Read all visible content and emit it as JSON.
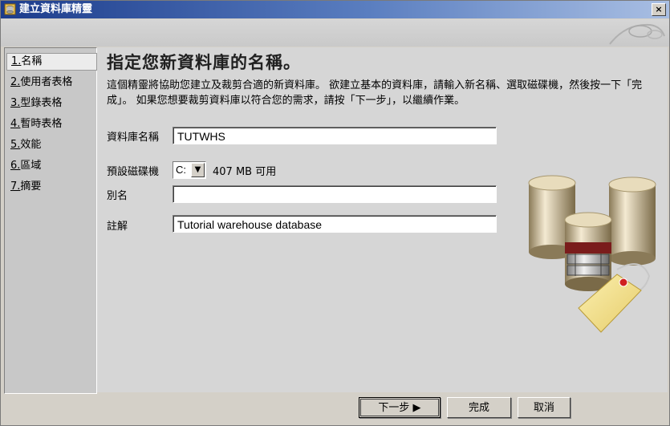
{
  "window": {
    "title": "建立資料庫精靈",
    "close_glyph": "×"
  },
  "steps": [
    {
      "num": "1.",
      "label": "名稱",
      "active": true
    },
    {
      "num": "2.",
      "label": "使用者表格"
    },
    {
      "num": "3.",
      "label": "型錄表格"
    },
    {
      "num": "4.",
      "label": "暫時表格"
    },
    {
      "num": "5.",
      "label": "效能"
    },
    {
      "num": "6.",
      "label": "區域"
    },
    {
      "num": "7.",
      "label": "摘要"
    }
  ],
  "main": {
    "heading": "指定您新資料庫的名稱。",
    "description": "這個精靈將協助您建立及裁剪合適的新資料庫。 欲建立基本的資料庫，請輸入新名稱、選取磁碟機，然後按一下「完成」。 如果您想要裁剪資料庫以符合您的需求，請按「下一步」，以繼續作業。",
    "db_name_label": "資料庫名稱",
    "db_name_value": "TUTWHS",
    "drive_label": "預設磁碟機",
    "drive_value": "C:",
    "drive_space": "407 MB 可用",
    "alias_label": "別名",
    "alias_value": "",
    "comment_label": "註解",
    "comment_value": "Tutorial warehouse database"
  },
  "buttons": {
    "next": "下一步 ▶",
    "finish": "完成",
    "cancel": "取消"
  },
  "icons": {
    "drive_dropdown": "chevron-down-icon",
    "title_icon": "database-wizard-icon",
    "illustration": "database-cylinders-illustration"
  }
}
